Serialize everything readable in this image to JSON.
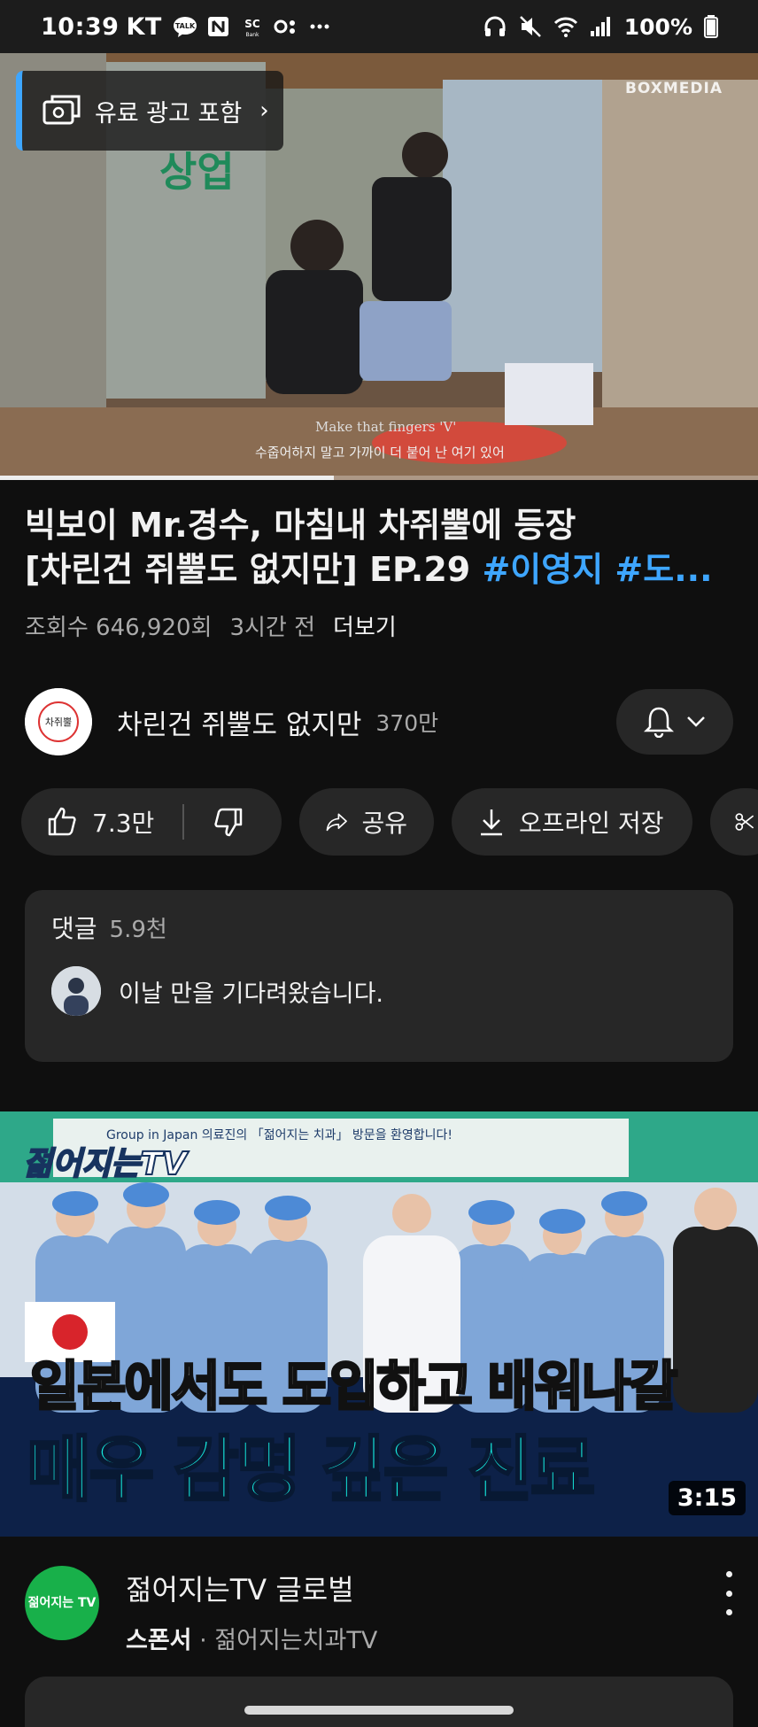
{
  "status_bar": {
    "time": "10:39",
    "carrier": "KT",
    "battery": "100%",
    "icons_left": [
      "talk-icon",
      "naver-icon",
      "bank-icon",
      "dots-app-icon",
      "more-dots-icon"
    ],
    "icons_right": [
      "headphones-icon",
      "mute-icon",
      "wifi-icon",
      "signal-icon",
      "battery-icon"
    ]
  },
  "player": {
    "paid_promotion_label": "유료 광고 포함",
    "watermark": "BOXMEDIA",
    "subtitle_en": "Make that fingers 'V'",
    "subtitle_ko": "수줍어하지 말고 가까이 더 붙어 난 여기 있어",
    "progress_fraction": 0.44
  },
  "video": {
    "title_line1": "빅보이 Mr.경수, 마침내 차쥐뿔에 등장",
    "title_line2_plain": "[차린건 쥐뿔도 없지만] EP.29 ",
    "title_line2_hashtags": "#이영지 #도...",
    "views": "조회수 646,920회",
    "age": "3시간 전",
    "more": "더보기"
  },
  "channel": {
    "name": "차린건 쥐뿔도 없지만",
    "subscribers": "370만"
  },
  "actions": {
    "like_count": "7.3만",
    "share": "공유",
    "offline": "오프라인 저장"
  },
  "comments": {
    "label": "댓글",
    "count": "5.9천",
    "first_comment": "이날 만을 기다려왔습니다."
  },
  "ad": {
    "brand_overlay": "젊어지는TV",
    "banner_text": "Group in Japan 의료진의 「젊어지는 치과」 방문을 환영합니다!",
    "headline_1": "일본에서도 도입하고 배워나갈",
    "headline_2": "매우 감명 깊은 진료",
    "duration": "3:15",
    "logo_text": "젊어지는 TV",
    "title": "젊어지는TV 글로벌",
    "sponsor_label": "스폰서",
    "sponsor_name": "젊어지는치과TV"
  },
  "colors": {
    "background": "#0f0f0f",
    "chip": "#272727",
    "hashtag": "#3ea6ff",
    "headline_cyan": "#15e8dd"
  }
}
